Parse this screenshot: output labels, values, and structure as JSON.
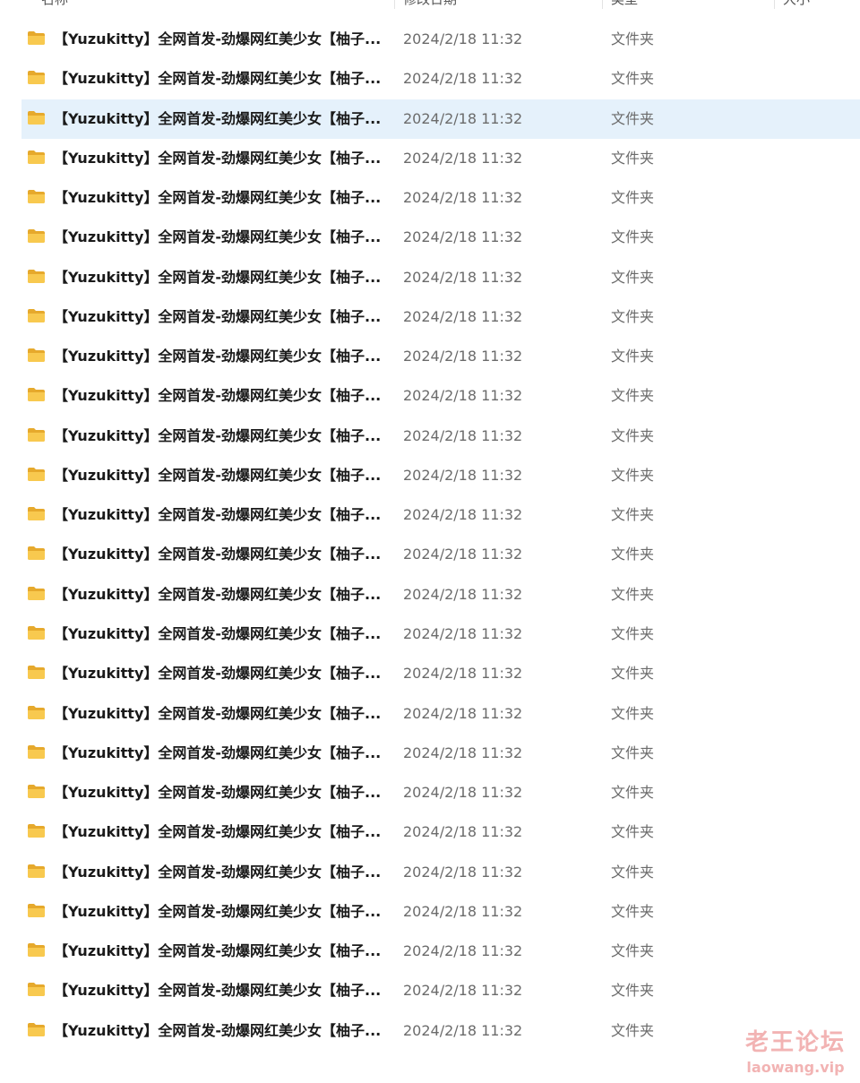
{
  "columns": {
    "name": "名称",
    "date": "修改日期",
    "type": "类型",
    "size": "大小"
  },
  "rows": [
    {
      "name": "【Yuzukitty】全网首发-劲爆网红美少女【柚子...",
      "date": "2024/2/18 11:32",
      "type": "文件夹"
    },
    {
      "name": "【Yuzukitty】全网首发-劲爆网红美少女【柚子...",
      "date": "2024/2/18 11:32",
      "type": "文件夹"
    },
    {
      "name": "【Yuzukitty】全网首发-劲爆网红美少女【柚子...",
      "date": "2024/2/18 11:32",
      "type": "文件夹"
    },
    {
      "name": "【Yuzukitty】全网首发-劲爆网红美少女【柚子...",
      "date": "2024/2/18 11:32",
      "type": "文件夹"
    },
    {
      "name": "【Yuzukitty】全网首发-劲爆网红美少女【柚子...",
      "date": "2024/2/18 11:32",
      "type": "文件夹"
    },
    {
      "name": "【Yuzukitty】全网首发-劲爆网红美少女【柚子...",
      "date": "2024/2/18 11:32",
      "type": "文件夹"
    },
    {
      "name": "【Yuzukitty】全网首发-劲爆网红美少女【柚子...",
      "date": "2024/2/18 11:32",
      "type": "文件夹"
    },
    {
      "name": "【Yuzukitty】全网首发-劲爆网红美少女【柚子...",
      "date": "2024/2/18 11:32",
      "type": "文件夹"
    },
    {
      "name": "【Yuzukitty】全网首发-劲爆网红美少女【柚子...",
      "date": "2024/2/18 11:32",
      "type": "文件夹"
    },
    {
      "name": "【Yuzukitty】全网首发-劲爆网红美少女【柚子...",
      "date": "2024/2/18 11:32",
      "type": "文件夹"
    },
    {
      "name": "【Yuzukitty】全网首发-劲爆网红美少女【柚子...",
      "date": "2024/2/18 11:32",
      "type": "文件夹"
    },
    {
      "name": "【Yuzukitty】全网首发-劲爆网红美少女【柚子...",
      "date": "2024/2/18 11:32",
      "type": "文件夹"
    },
    {
      "name": "【Yuzukitty】全网首发-劲爆网红美少女【柚子...",
      "date": "2024/2/18 11:32",
      "type": "文件夹"
    },
    {
      "name": "【Yuzukitty】全网首发-劲爆网红美少女【柚子...",
      "date": "2024/2/18 11:32",
      "type": "文件夹"
    },
    {
      "name": "【Yuzukitty】全网首发-劲爆网红美少女【柚子...",
      "date": "2024/2/18 11:32",
      "type": "文件夹"
    },
    {
      "name": "【Yuzukitty】全网首发-劲爆网红美少女【柚子...",
      "date": "2024/2/18 11:32",
      "type": "文件夹"
    },
    {
      "name": "【Yuzukitty】全网首发-劲爆网红美少女【柚子...",
      "date": "2024/2/18 11:32",
      "type": "文件夹"
    },
    {
      "name": "【Yuzukitty】全网首发-劲爆网红美少女【柚子...",
      "date": "2024/2/18 11:32",
      "type": "文件夹"
    },
    {
      "name": "【Yuzukitty】全网首发-劲爆网红美少女【柚子...",
      "date": "2024/2/18 11:32",
      "type": "文件夹"
    },
    {
      "name": "【Yuzukitty】全网首发-劲爆网红美少女【柚子...",
      "date": "2024/2/18 11:32",
      "type": "文件夹"
    },
    {
      "name": "【Yuzukitty】全网首发-劲爆网红美少女【柚子...",
      "date": "2024/2/18 11:32",
      "type": "文件夹"
    },
    {
      "name": "【Yuzukitty】全网首发-劲爆网红美少女【柚子...",
      "date": "2024/2/18 11:32",
      "type": "文件夹"
    },
    {
      "name": "【Yuzukitty】全网首发-劲爆网红美少女【柚子...",
      "date": "2024/2/18 11:32",
      "type": "文件夹"
    },
    {
      "name": "【Yuzukitty】全网首发-劲爆网红美少女【柚子...",
      "date": "2024/2/18 11:32",
      "type": "文件夹"
    },
    {
      "name": "【Yuzukitty】全网首发-劲爆网红美少女【柚子...",
      "date": "2024/2/18 11:32",
      "type": "文件夹"
    },
    {
      "name": "【Yuzukitty】全网首发-劲爆网红美少女【柚子...",
      "date": "2024/2/18 11:32",
      "type": "文件夹"
    }
  ],
  "selected_row": 2,
  "watermark": {
    "title": "老王论坛",
    "url": "laowang.vip"
  },
  "colors": {
    "folder": "#f5c242",
    "selection": "#e5f1fb",
    "watermark": "#f2b3b3"
  }
}
